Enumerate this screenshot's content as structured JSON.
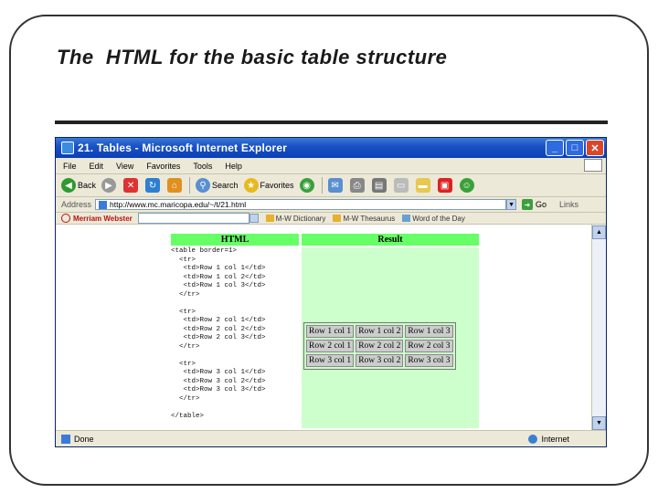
{
  "slide": {
    "title": "The  HTML for the basic table structure"
  },
  "window": {
    "title": "21. Tables - Microsoft Internet Explorer",
    "minimize": "_",
    "maximize": "□",
    "close": "✕"
  },
  "menu": [
    "File",
    "Edit",
    "View",
    "Favorites",
    "Tools",
    "Help"
  ],
  "toolbar": {
    "back": "Back",
    "search": "Search",
    "favorites": "Favorites"
  },
  "address": {
    "label": "Address",
    "url": "http://www.mc.maricopa.edu/~/t/21.html",
    "go": "Go",
    "links": "Links"
  },
  "links_bar": {
    "merriam": "Merriam Webster",
    "link1": "M-W Dictionary",
    "link2": "M-W Thesaurus",
    "link3": "Word of the Day"
  },
  "content": {
    "html_header": "HTML",
    "result_header": "Result",
    "code_lines": "<table border=1>\n  <tr>\n   <td>Row 1 col 1</td>\n   <td>Row 1 col 2</td>\n   <td>Row 1 col 3</td>\n  </tr>\n\n  <tr>\n   <td>Row 2 col 1</td>\n   <td>Row 2 col 2</td>\n   <td>Row 2 col 3</td>\n  </tr>\n\n  <tr>\n   <td>Row 3 col 1</td>\n   <td>Row 3 col 2</td>\n   <td>Row 3 col 3</td>\n  </tr>\n\n</table>",
    "table": [
      [
        "Row 1 col 1",
        "Row 1 col 2",
        "Row 1 col 3"
      ],
      [
        "Row 2 col 1",
        "Row 2 col 2",
        "Row 2 col 3"
      ],
      [
        "Row 3 col 1",
        "Row 3 col 2",
        "Row 3 col 3"
      ]
    ]
  },
  "status": {
    "left": "Done",
    "zone": "Internet"
  },
  "colors": {
    "header_green": "#66ff66",
    "result_bg": "#ccffcc",
    "titlebar_blue": "#0a3fb5"
  }
}
